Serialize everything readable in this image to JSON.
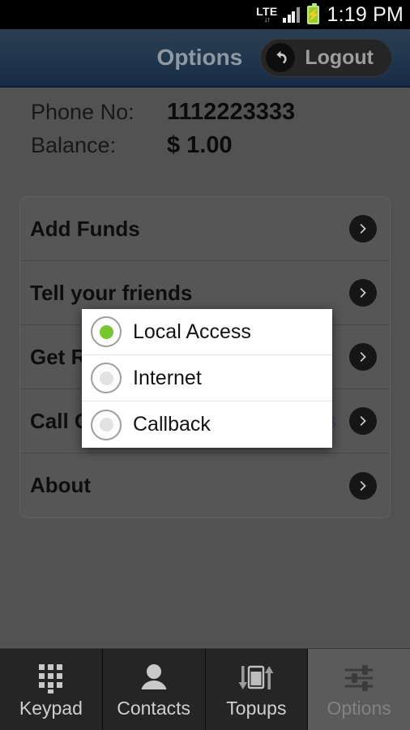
{
  "statusbar": {
    "network": "LTE",
    "data_arrows": "↓↑",
    "battery_icon": "battery-charging-icon",
    "signal_icon": "signal-bars-icon",
    "clock": "1:19 PM"
  },
  "actionbar": {
    "title": "Options",
    "logout_label": "Logout",
    "logout_icon": "back-arrow-icon"
  },
  "account": {
    "phone_label": "Phone No:",
    "phone_value": "1112223333",
    "balance_label": "Balance:",
    "balance_value": "$ 1.00"
  },
  "options_list": [
    {
      "label": "Add Funds",
      "value": "",
      "icon": "chevron-right-icon"
    },
    {
      "label": "Tell your friends",
      "value": "",
      "icon": "chevron-right-icon"
    },
    {
      "label": "Get Rates",
      "value": "",
      "icon": "chevron-right-icon"
    },
    {
      "label": "Call Option",
      "value": "Local Access",
      "icon": "chevron-right-icon"
    },
    {
      "label": "About",
      "value": "",
      "icon": "chevron-right-icon"
    }
  ],
  "dialog": {
    "choices": [
      {
        "label": "Local Access",
        "selected": true
      },
      {
        "label": "Internet",
        "selected": false
      },
      {
        "label": "Callback",
        "selected": false
      }
    ]
  },
  "tabs": [
    {
      "label": "Keypad",
      "icon": "dialpad-icon",
      "active": false
    },
    {
      "label": "Contacts",
      "icon": "person-icon",
      "active": false
    },
    {
      "label": "Topups",
      "icon": "topup-calendar-icon",
      "active": false
    },
    {
      "label": "Options",
      "icon": "sliders-icon",
      "active": true
    }
  ],
  "colors": {
    "body_bg": "#5e5e5e",
    "actionbar_top": "#33475c",
    "actionbar_bottom": "#1a3350",
    "radio_selected": "#76c72e",
    "value_text": "#3d4f63",
    "tab_active_bg": "#5b5b5b"
  }
}
